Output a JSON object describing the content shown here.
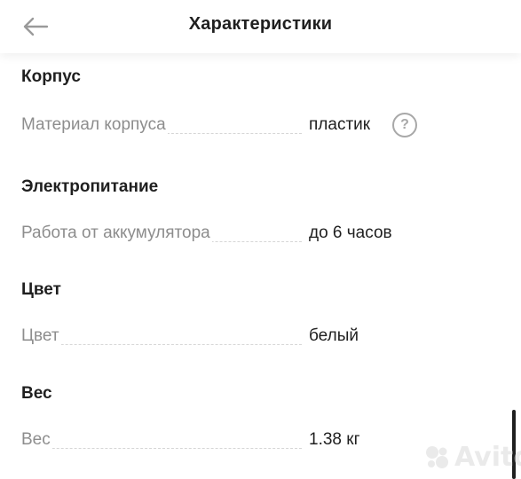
{
  "header": {
    "title": "Характеристики",
    "back_icon": "arrow-left-icon"
  },
  "sections": [
    {
      "title": "Корпус",
      "rows": [
        {
          "label": "Материал корпуса",
          "value": "пластик",
          "help_icon": "help-circle-icon"
        }
      ]
    },
    {
      "title": "Электропитание",
      "rows": [
        {
          "label": "Работа от аккумулятора",
          "value": "до 6 часов"
        }
      ]
    },
    {
      "title": "Цвет",
      "rows": [
        {
          "label": "Цвет",
          "value": "белый"
        }
      ]
    },
    {
      "title": "Вес",
      "rows": [
        {
          "label": "Вес",
          "value": "1.38 кг"
        }
      ]
    }
  ],
  "watermark": {
    "text": "Avito"
  },
  "colors": {
    "text_primary": "#1f1f1f",
    "text_secondary": "#8d8d8d",
    "divider_dash": "#d6d6d6",
    "icon_gray": "#a8a8a8"
  }
}
